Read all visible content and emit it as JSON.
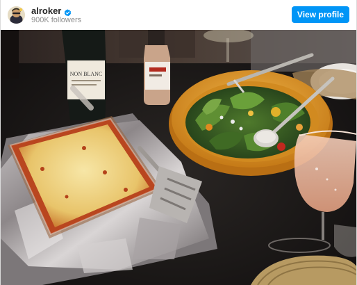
{
  "header": {
    "username": "alroker",
    "followers": "900K followers",
    "view_profile_label": "View profile",
    "verified": true,
    "accent_color": "#0095f6"
  },
  "post": {
    "media_type": "photo",
    "bottle_label": "SAUVIGNON BLANC",
    "bottle_label_partial": "NON BLANC"
  },
  "icons": [
    "avatar-icon",
    "verified-badge-icon"
  ]
}
